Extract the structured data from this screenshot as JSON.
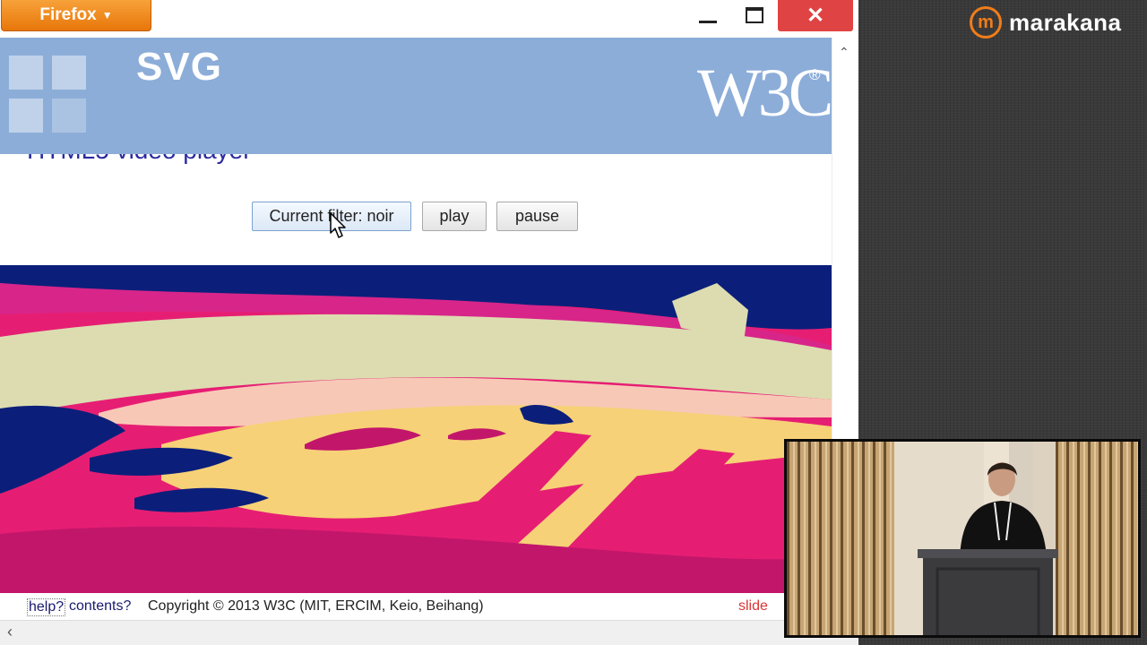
{
  "browser": {
    "menu_label": "Firefox",
    "menu_caret": "▼",
    "close_glyph": "✕"
  },
  "slide": {
    "header_title": "SVG",
    "w3c_logo_text": "W3C",
    "w3c_registered": "®",
    "subtitle_fragment": "HTML5 video player"
  },
  "controls": {
    "filter_label": "Current filter: noir",
    "play_label": "play",
    "pause_label": "pause"
  },
  "status": {
    "help_label": "help?",
    "contents_label": "contents?",
    "copyright": "Copyright © 2013 W3C (MIT, ERCIM, Keio, Beihang)",
    "slide_label": "slide"
  },
  "scrollbars": {
    "up_glyph": "⌃",
    "left_glyph": "‹"
  },
  "brand": {
    "icon_letter": "m",
    "name": "marakana",
    "accent_color": "#f07d1a"
  },
  "icons": {
    "menu_caret": "chevron-down-icon",
    "minimize": "minimize-icon",
    "maximize": "maximize-icon",
    "close": "close-icon",
    "cursor": "mouse-pointer-icon"
  },
  "colors": {
    "firefox_orange": "#e8760a",
    "close_red": "#e04343",
    "header_blue": "#8cadd8",
    "link_navy": "#1a1a6e",
    "slide_red": "#d93636",
    "filter_magenta": "#e61e73",
    "filter_navy": "#0b1f7a",
    "filter_yellow": "#f6d177",
    "filter_cream": "#dcdcb0",
    "filter_peach": "#f7c8b6"
  }
}
